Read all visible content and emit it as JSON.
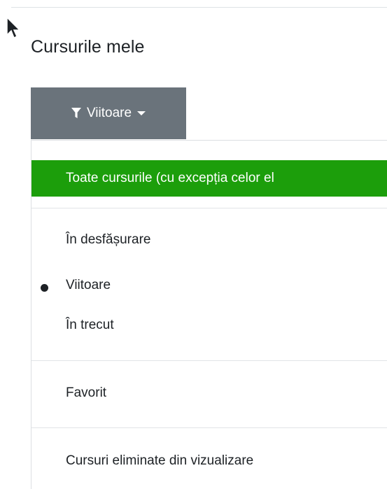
{
  "page": {
    "title": "Cursurile mele"
  },
  "filter": {
    "button_label": "Viitoare",
    "icon": "filter-icon",
    "caret_icon": "caret-down-icon"
  },
  "menu": {
    "all_courses": "Toate cursurile (cu excepția celor el",
    "in_progress": "În desfășurare",
    "future": "Viitoare",
    "past": "În trecut",
    "favourites": "Favorit",
    "hidden": "Cursuri eliminate din vizualizare",
    "selected": "future"
  },
  "colors": {
    "button_bg": "#6a737b",
    "highlight": "#1c9e0b"
  }
}
